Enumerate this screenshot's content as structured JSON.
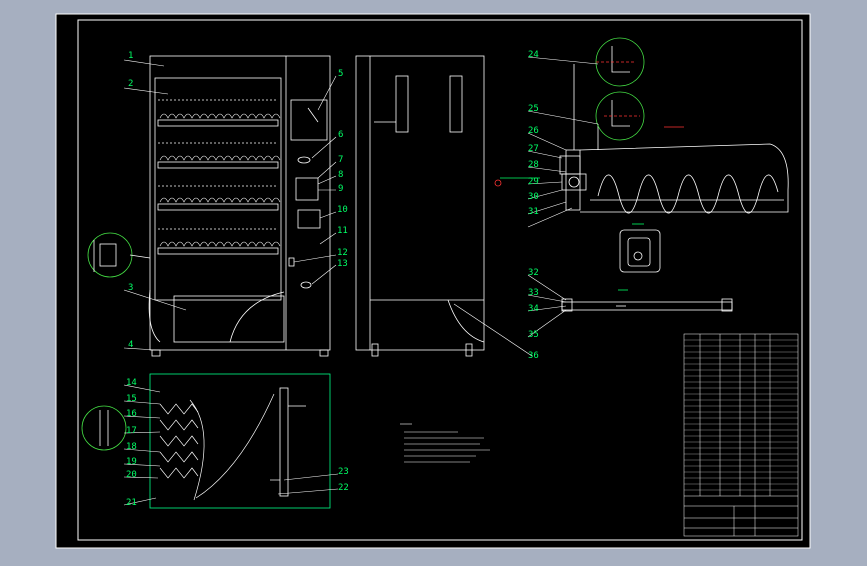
{
  "drawing": {
    "background_color": "#a6afc0",
    "paper_color": "#000000",
    "line_color": "#ffffff",
    "callout_color": "#00ff66",
    "detail_color": "#44dd44",
    "red_color": "#ff3333"
  },
  "callouts": {
    "c1": "1",
    "c2": "2",
    "c3": "3",
    "c4": "4",
    "c5": "5",
    "c6": "6",
    "c7": "7",
    "c8": "8",
    "c9": "9",
    "c10": "10",
    "c11": "11",
    "c12": "12",
    "c13": "13",
    "c14": "14",
    "c15": "15",
    "c16": "16",
    "c17": "17",
    "c18": "18",
    "c19": "19",
    "c20": "20",
    "c21": "21",
    "c22": "22",
    "c23": "23",
    "c24": "24",
    "c25": "25",
    "c26": "26",
    "c27": "27",
    "c28": "28",
    "c29": "29",
    "c30": "30",
    "c31": "31",
    "c32": "32",
    "c33": "33",
    "c34": "34",
    "c35": "35",
    "c36": "36"
  }
}
